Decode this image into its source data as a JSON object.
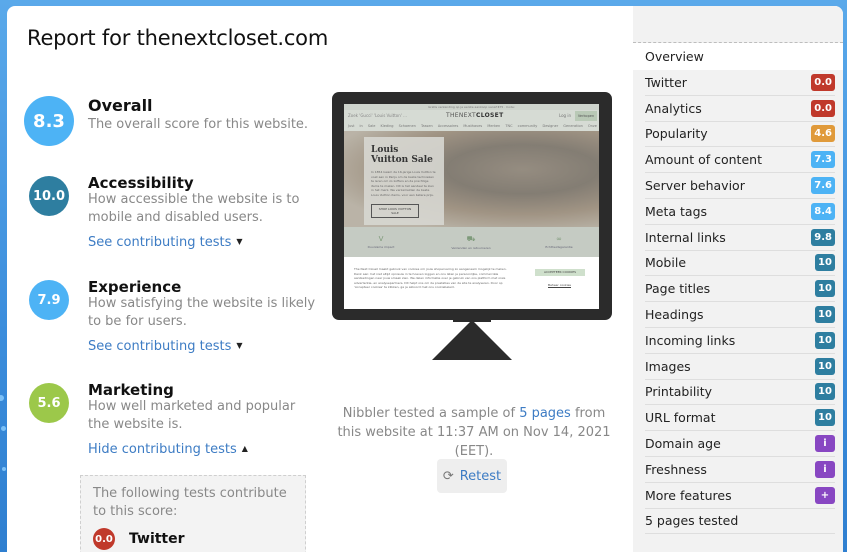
{
  "title": "Report for thenextcloset.com",
  "scores": [
    {
      "value": "8.3",
      "name": "Overall",
      "description": "The overall score for this website.",
      "color": "#4db3f5"
    },
    {
      "value": "10.0",
      "name": "Accessibility",
      "description": "How accessible the website is to mobile and disabled users.",
      "toggle": "See contributing tests",
      "toggle_icon": "caret-down-icon",
      "color": "#2e7ea0"
    },
    {
      "value": "7.9",
      "name": "Experience",
      "description": "How satisfying the website is likely to be for users.",
      "toggle": "See contributing tests",
      "toggle_icon": "caret-down-icon",
      "color": "#4db3f5"
    },
    {
      "value": "5.6",
      "name": "Marketing",
      "description": "How well marketed and popular the website is.",
      "toggle": "Hide contributing tests",
      "toggle_icon": "caret-up-icon",
      "color": "#9cc84a"
    }
  ],
  "contributing": {
    "intro": "The following tests contribute to this score:",
    "tests": [
      {
        "score": "0.0",
        "name": "Twitter",
        "color": "#c0392b"
      }
    ]
  },
  "preview": {
    "topbar": "Gratis verzending op je eerste aankoop vanaf €75 · Code: ",
    "search": "Zoek 'Gucci' 'Louis Vuitton' ...",
    "logo_light": "THENEXT",
    "logo_bold": "CLOSET",
    "login": "Log in",
    "sell": "Verkopen",
    "nav": "Just in   Sale   Kleding   Schoenen   Tassen   Accessoires   Musthaves   Merken   TNC community   Designer Generation   Onze missie   NL",
    "promo_title": "Louis Vuitton Sale",
    "promo_text": "In 1854 kwam de 16-jarige Louis Vuitton te voet aan in Parijs om de beste technieken te leren om zo koffers en de prachtige items te maken. Dit is het aandeel te zien in het merk. We verzamelden de beste Louis Vuitton items, voor een betere prijs.",
    "promo_button": "SHOP LOUIS VUITTON SALE",
    "features": [
      "Duurzame impact",
      "Verzenden en retourneren",
      "Echtheidsgarantie"
    ],
    "cookie_text": "The Next Closet maakt gebruik van cookies om jouw shopervaring zo aangenaam mogelijk te maken. Denk aan: het niet altijd opnieuw in te hoeven loggen en ons laten je persoonlijke, commerciële aanbiedingen naar jouw smaak zien. We delen informatie over je gebruik van ons platform met onze advertentie- en analysepartners. Dit helpt ons om de prestaties van de site te analyseren. Door op 'Accepteer cookies' te klikken, ga je akkoord met ons cookiebeleid.",
    "cookie_accept": "ACCEPTEER COOKIES",
    "cookie_reject": "Beheer cookies"
  },
  "tested": {
    "prefix": "Nibbler tested a sample of ",
    "link": "5 pages",
    "suffix": " from this website at 11:37 AM on Nov 14, 2021 (EET)."
  },
  "retest": {
    "label": "Retest",
    "icon": "refresh-icon"
  },
  "sidebar": {
    "overview": "Overview",
    "items": [
      {
        "label": "Twitter",
        "badge": "0.0",
        "color": "#c0392b"
      },
      {
        "label": "Analytics",
        "badge": "0.0",
        "color": "#c0392b"
      },
      {
        "label": "Popularity",
        "badge": "4.6",
        "color": "#e09a3a"
      },
      {
        "label": "Amount of content",
        "badge": "7.3",
        "color": "#4db3f5"
      },
      {
        "label": "Server behavior",
        "badge": "7.6",
        "color": "#4db3f5"
      },
      {
        "label": "Meta tags",
        "badge": "8.4",
        "color": "#4db3f5"
      },
      {
        "label": "Internal links",
        "badge": "9.8",
        "color": "#2e7ea0"
      },
      {
        "label": "Mobile",
        "badge": "10",
        "color": "#2e7ea0"
      },
      {
        "label": "Page titles",
        "badge": "10",
        "color": "#2e7ea0"
      },
      {
        "label": "Headings",
        "badge": "10",
        "color": "#2e7ea0"
      },
      {
        "label": "Incoming links",
        "badge": "10",
        "color": "#2e7ea0"
      },
      {
        "label": "Images",
        "badge": "10",
        "color": "#2e7ea0"
      },
      {
        "label": "Printability",
        "badge": "10",
        "color": "#2e7ea0"
      },
      {
        "label": "URL format",
        "badge": "10",
        "color": "#2e7ea0"
      },
      {
        "label": "Domain age",
        "badge": "i",
        "color": "#8847c2"
      },
      {
        "label": "Freshness",
        "badge": "i",
        "color": "#8847c2"
      },
      {
        "label": "More features",
        "badge": "+",
        "color": "#8847c2"
      },
      {
        "label": "5 pages tested",
        "badge": null,
        "color": null
      }
    ]
  }
}
